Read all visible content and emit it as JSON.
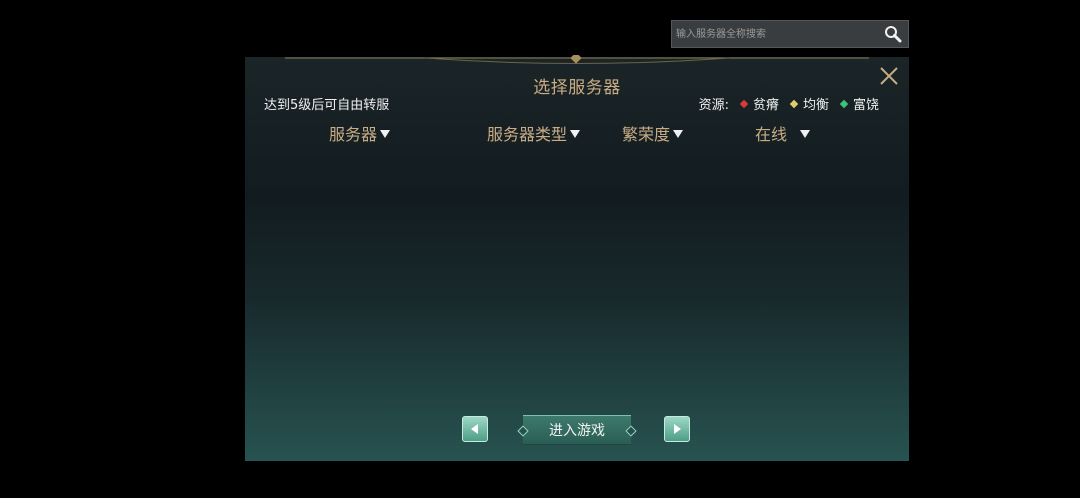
{
  "search": {
    "placeholder": "输入服务器全称搜索"
  },
  "panel": {
    "title": "选择服务器",
    "hint": "达到5级后可自由转服",
    "legend": {
      "label": "资源:",
      "items": [
        {
          "label": "贫瘠",
          "color": "#d83a3a"
        },
        {
          "label": "均衡",
          "color": "#e2cd6a"
        },
        {
          "label": "富饶",
          "color": "#3ebf7a"
        }
      ]
    },
    "columns": [
      {
        "label": "服务器"
      },
      {
        "label": "服务器类型"
      },
      {
        "label": "繁荣度"
      },
      {
        "label": "在线 "
      }
    ],
    "enter_label": "进入游戏"
  },
  "colors": {
    "accent": "#c9ac84",
    "button": "#3d7a6c"
  }
}
